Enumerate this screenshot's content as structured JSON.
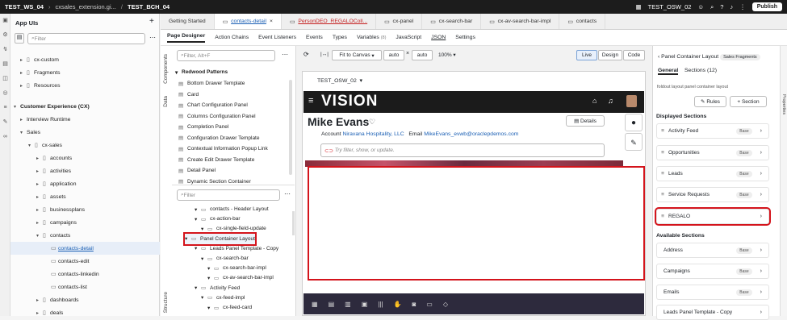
{
  "topbar": {
    "workspace": "TEST_WS_04",
    "path": "cxsales_extension.gi...",
    "branch": "TEST_BCH_04",
    "user": "TEST_OSW_02",
    "publish": "Publish"
  },
  "leftnav": {
    "title": "App UIs",
    "filter_placeholder": "Filter",
    "items": [
      {
        "label": "cx-custom",
        "level": 1
      },
      {
        "label": "Fragments",
        "level": 1
      },
      {
        "label": "Resources",
        "level": 1
      },
      {
        "label": "Customer Experience (CX)",
        "level": 0
      },
      {
        "label": "Interview Runtime",
        "level": 1
      },
      {
        "label": "Sales",
        "level": 1
      },
      {
        "label": "cx-sales",
        "level": 2
      },
      {
        "label": "accounts",
        "level": 3
      },
      {
        "label": "activities",
        "level": 3
      },
      {
        "label": "application",
        "level": 3
      },
      {
        "label": "assets",
        "level": 3
      },
      {
        "label": "businessplans",
        "level": 3
      },
      {
        "label": "campaigns",
        "level": 3
      },
      {
        "label": "contacts",
        "level": 3
      },
      {
        "label": "contacts-detail",
        "level": 4
      },
      {
        "label": "contacts-edit",
        "level": 4
      },
      {
        "label": "contacts-linkedin",
        "level": 4
      },
      {
        "label": "contacts-list",
        "level": 4
      },
      {
        "label": "dashboards",
        "level": 3
      },
      {
        "label": "deals",
        "level": 3
      }
    ]
  },
  "tabs": [
    {
      "label": "Getting Started"
    },
    {
      "label": "contacts-detail"
    },
    {
      "label": "PersonDEO_REGALOColl..."
    },
    {
      "label": "cx-panel"
    },
    {
      "label": "cx-search-bar"
    },
    {
      "label": "cx-av-search-bar-impl"
    },
    {
      "label": "contacts"
    }
  ],
  "subtabs": [
    {
      "label": "Page Designer"
    },
    {
      "label": "Action Chains"
    },
    {
      "label": "Event Listeners"
    },
    {
      "label": "Events"
    },
    {
      "label": "Types"
    },
    {
      "label": "Variables"
    },
    {
      "label": "JavaScript"
    },
    {
      "label": "JSON"
    },
    {
      "label": "Settings"
    }
  ],
  "variables_count": "(8)",
  "components": {
    "label_components": "Components",
    "label_data": "Data",
    "label_structure": "Structure",
    "filter_placeholder": "Filter, Alt+F",
    "group": "Redwood Patterns",
    "items": [
      "Bottom Drawer Template",
      "Card",
      "Chart Configuration Panel",
      "Columns Configuration Panel",
      "Completion Panel",
      "Configuration Drawer Template",
      "Contextual Information Popup Link",
      "Create Edit Drawer Template",
      "Detail Panel",
      "Dynamic Section Container"
    ],
    "structure_filter": "Filter",
    "structure": [
      {
        "label": "contacts - Header Layout",
        "level": 1
      },
      {
        "label": "cx-action-bar",
        "level": 1
      },
      {
        "label": "cx-single-field-update",
        "level": 2
      },
      {
        "label": "Panel Container Layout",
        "level": 0
      },
      {
        "label": "Leads Panel Template - Copy",
        "level": 1
      },
      {
        "label": "cx-search-bar",
        "level": 2
      },
      {
        "label": "cx-search-bar-impl",
        "level": 3
      },
      {
        "label": "cx-av-search-bar-impl",
        "level": 3
      },
      {
        "label": "Activity Feed",
        "level": 1
      },
      {
        "label": "cx-feed-impl",
        "level": 2
      },
      {
        "label": "cx-feed-card",
        "level": 3
      }
    ]
  },
  "canvas": {
    "fit": "Fit to Canvas",
    "w": "auto",
    "h": "auto",
    "zoom": "100%",
    "modes": [
      "Live",
      "Design",
      "Code"
    ],
    "device": "TEST_OSW_02",
    "brand": "VISION",
    "name": "Mike Evans",
    "account_label": "Account",
    "account": "Niravana Hospitality, LLC",
    "email_label": "Email",
    "email": "MikeEvans_evwb@oraclepdemos.com",
    "details": "Details",
    "search_placeholder": "Try filter, show, or update."
  },
  "rpanel": {
    "back": "Panel Container Layout",
    "badge": "Sales Fragments",
    "tab_general": "General",
    "tab_sections": "Sections (12)",
    "desc": "foldout layout panel container layout",
    "rules": "Rules",
    "add": "Section",
    "displayed": "Displayed Sections",
    "displayed_items": [
      {
        "label": "Activity Feed",
        "badge": "Base"
      },
      {
        "label": "Opportunities",
        "badge": "Base"
      },
      {
        "label": "Leads",
        "badge": "Base"
      },
      {
        "label": "Service Requests",
        "badge": "Base"
      },
      {
        "label": "REGALO",
        "badge": ""
      }
    ],
    "available": "Available Sections",
    "available_items": [
      {
        "label": "Address",
        "badge": "Base"
      },
      {
        "label": "Campaigns",
        "badge": "Base"
      },
      {
        "label": "Emails",
        "badge": "Base"
      },
      {
        "label": "Leads Panel Template - Copy",
        "badge": ""
      }
    ],
    "properties": "Properties"
  }
}
